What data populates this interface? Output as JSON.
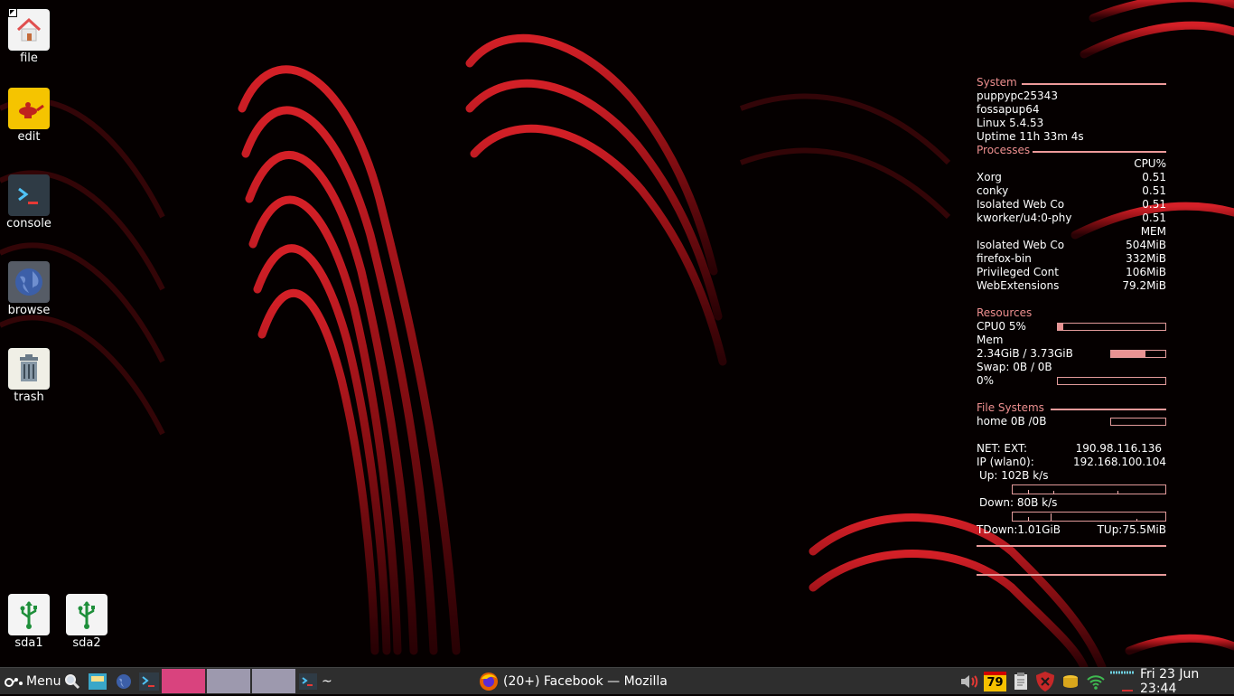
{
  "desktop": {
    "icons": [
      {
        "label": "file",
        "icon": "home-folder-icon"
      },
      {
        "label": "edit",
        "icon": "genie-lamp-icon"
      },
      {
        "label": "console",
        "icon": "terminal-icon"
      },
      {
        "label": "browse",
        "icon": "globe-icon"
      },
      {
        "label": "trash",
        "icon": "trash-icon"
      },
      {
        "label": "sda1",
        "icon": "usb-icon"
      },
      {
        "label": "sda2",
        "icon": "usb-icon"
      }
    ]
  },
  "conky": {
    "system": {
      "heading": "System",
      "hostname": "puppypc25343",
      "distro": "fossapup64",
      "kernel": "Linux 5.4.53",
      "uptime": "Uptime 11h 33m 4s"
    },
    "processes": {
      "heading": "Processes",
      "cpu_header": "CPU%",
      "cpu": [
        {
          "name": "Xorg",
          "value": "0.51"
        },
        {
          "name": "conky",
          "value": "0.51"
        },
        {
          "name": "Isolated Web Co",
          "value": "0.51"
        },
        {
          "name": "kworker/u4:0-phy",
          "value": "0.51"
        }
      ],
      "mem_header": "MEM",
      "mem": [
        {
          "name": "Isolated Web Co",
          "value": "504MiB"
        },
        {
          "name": "firefox-bin",
          "value": "332MiB"
        },
        {
          "name": "Privileged Cont",
          "value": "106MiB"
        },
        {
          "name": "WebExtensions",
          "value": "79.2MiB"
        }
      ]
    },
    "resources": {
      "heading": "Resources",
      "cpu_label": "CPU0 5%",
      "cpu_fraction": 0.05,
      "mem_label": "Mem",
      "mem_value": "2.34GiB / 3.73GiB",
      "mem_fraction": 0.63,
      "swap_label": "Swap: 0B   / 0B",
      "swap_percent": "0%",
      "swap_fraction": 0
    },
    "filesystems": {
      "heading": "File Systems",
      "home": "home 0B  /0B",
      "home_fraction": 0
    },
    "net": {
      "ext_label": "NET: EXT:",
      "ext_ip": "190.98.116.136",
      "ip_label": "IP (wlan0):",
      "ip": "192.168.100.104",
      "up": "Up: 102B   k/s",
      "down": "Down: 80B  k/s",
      "tdown": "TDown:1.01GiB",
      "tup": "TUp:75.5MiB"
    },
    "accent_color": "#ee8f8f"
  },
  "taskbar": {
    "menu_label": "Menu",
    "window_title": "(20+) Facebook — Mozilla",
    "tilde": "~",
    "pagers": [
      "#d9437e",
      "#9d99ae",
      "#9d99ae"
    ],
    "tray": {
      "battery_value": "79",
      "datetime": "Fri 23 Jun 23:44"
    }
  }
}
